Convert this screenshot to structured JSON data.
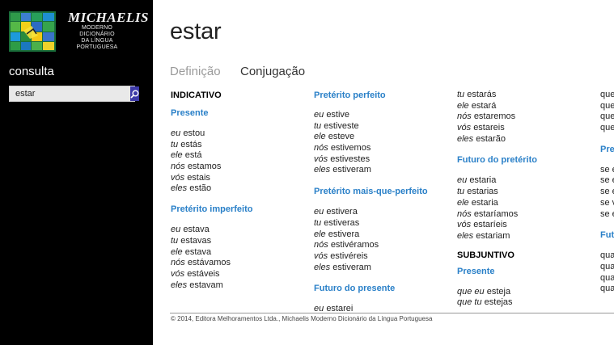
{
  "sidebar": {
    "brand_name": "MICHAELIS",
    "brand_lines": [
      "MODERNO",
      "DICIONÁRIO",
      "DA LÍNGUA",
      "PORTUGUESA"
    ],
    "search_label": "consulta",
    "search_value": "estar",
    "search_icon": "search-icon"
  },
  "main": {
    "title": "estar",
    "tabs": [
      {
        "label": "Definição",
        "active": false
      },
      {
        "label": "Conjugação",
        "active": true
      }
    ],
    "col1": {
      "mood": "INDICATIVO",
      "presente": {
        "title": "Presente",
        "rows": [
          [
            "eu",
            "estou"
          ],
          [
            "tu",
            "estás"
          ],
          [
            "ele",
            "está"
          ],
          [
            "nós",
            "estamos"
          ],
          [
            "vós",
            "estais"
          ],
          [
            "eles",
            "estão"
          ]
        ]
      },
      "imperfeito": {
        "title": "Pretérito imperfeito",
        "rows": [
          [
            "eu",
            "estava"
          ],
          [
            "tu",
            "estavas"
          ],
          [
            "ele",
            "estava"
          ],
          [
            "nós",
            "estávamos"
          ],
          [
            "vós",
            "estáveis"
          ],
          [
            "eles",
            "estavam"
          ]
        ]
      }
    },
    "col2": {
      "perfeito": {
        "title": "Pretérito perfeito",
        "rows": [
          [
            "eu",
            "estive"
          ],
          [
            "tu",
            "estiveste"
          ],
          [
            "ele",
            "esteve"
          ],
          [
            "nós",
            "estivemos"
          ],
          [
            "vós",
            "estivestes"
          ],
          [
            "eles",
            "estiveram"
          ]
        ]
      },
      "mais_que_perfeito": {
        "title": "Pretérito mais-que-perfeito",
        "rows": [
          [
            "eu",
            "estivera"
          ],
          [
            "tu",
            "estiveras"
          ],
          [
            "ele",
            "estivera"
          ],
          [
            "nós",
            "estivéramos"
          ],
          [
            "vós",
            "estivéreis"
          ],
          [
            "eles",
            "estiveram"
          ]
        ]
      },
      "futuro_presente": {
        "title": "Futuro do presente",
        "rows": [
          [
            "eu",
            "estarei"
          ]
        ]
      }
    },
    "col3": {
      "futuro_presente_cont": {
        "rows": [
          [
            "tu",
            "estarás"
          ],
          [
            "ele",
            "estará"
          ],
          [
            "nós",
            "estaremos"
          ],
          [
            "vós",
            "estareis"
          ],
          [
            "eles",
            "estarão"
          ]
        ]
      },
      "futuro_preterito": {
        "title": "Futuro do pretérito",
        "rows": [
          [
            "eu",
            "estaria"
          ],
          [
            "tu",
            "estarias"
          ],
          [
            "ele",
            "estaria"
          ],
          [
            "nós",
            "estaríamos"
          ],
          [
            "vós",
            "estaríeis"
          ],
          [
            "eles",
            "estariam"
          ]
        ]
      },
      "mood2": "SUBJUNTIVO",
      "presente_subj": {
        "title": "Presente",
        "rows": [
          [
            "que eu",
            "esteja"
          ],
          [
            "que tu",
            "estejas"
          ]
        ]
      }
    },
    "col4": {
      "rows_a": [
        "que",
        "que",
        "que",
        "que"
      ],
      "heading_a": "Pre",
      "rows_b": [
        "se e",
        "se e",
        "se e",
        "se v",
        "se e"
      ],
      "heading_b": "Fut",
      "rows_c": [
        "qua",
        "qua",
        "qua",
        "qua"
      ]
    },
    "footer": "© 2014, Editora Melhoramentos Ltda., Michaelis Moderno Dicionário da Língua Portuguesa"
  },
  "colors": {
    "sidebar_bg": "#000000",
    "accent_blue": "#2a80c8",
    "search_button": "#3d3aa8"
  }
}
